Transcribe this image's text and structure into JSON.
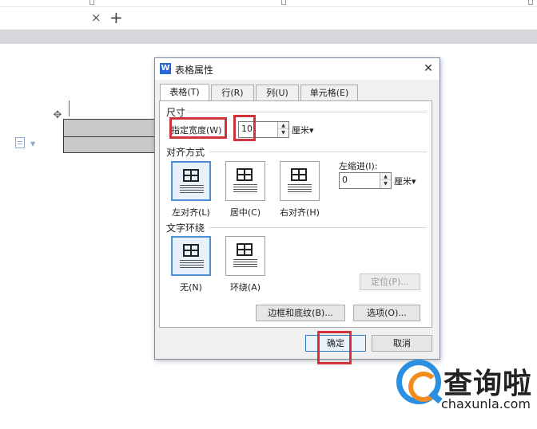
{
  "app": {
    "tab_close": "×",
    "tab_add": "+"
  },
  "document": {
    "move_handle_icon": "four-arrow-move-icon"
  },
  "dialog": {
    "app_icon": "W",
    "title": "表格属性",
    "close": "✕",
    "tabs": [
      "表格(T)",
      "行(R)",
      "列(U)",
      "单元格(E)"
    ],
    "size": {
      "section": "尺寸",
      "width_label": "指定宽度(W)",
      "width_value": "10",
      "unit": "厘米▾"
    },
    "alignment": {
      "section": "对齐方式",
      "options": [
        "左对齐(L)",
        "居中(C)",
        "右对齐(H)"
      ],
      "selected": "左对齐(L)",
      "indent_label": "左缩进(I):",
      "indent_value": "0",
      "indent_unit": "厘米▾"
    },
    "wrapping": {
      "section": "文字环绕",
      "options": [
        "无(N)",
        "环绕(A)"
      ],
      "selected": "无(N)",
      "position_button": "定位(P)..."
    },
    "borders_button": "边框和底纹(B)...",
    "options_button": "选项(O)...",
    "ok": "确定",
    "cancel": "取消"
  },
  "watermark": {
    "name": "查询啦",
    "url": "chaxunla.com"
  },
  "colors": {
    "highlight": "#d0343a",
    "accent": "#2b67d4",
    "selected_border": "#4d90d8"
  }
}
